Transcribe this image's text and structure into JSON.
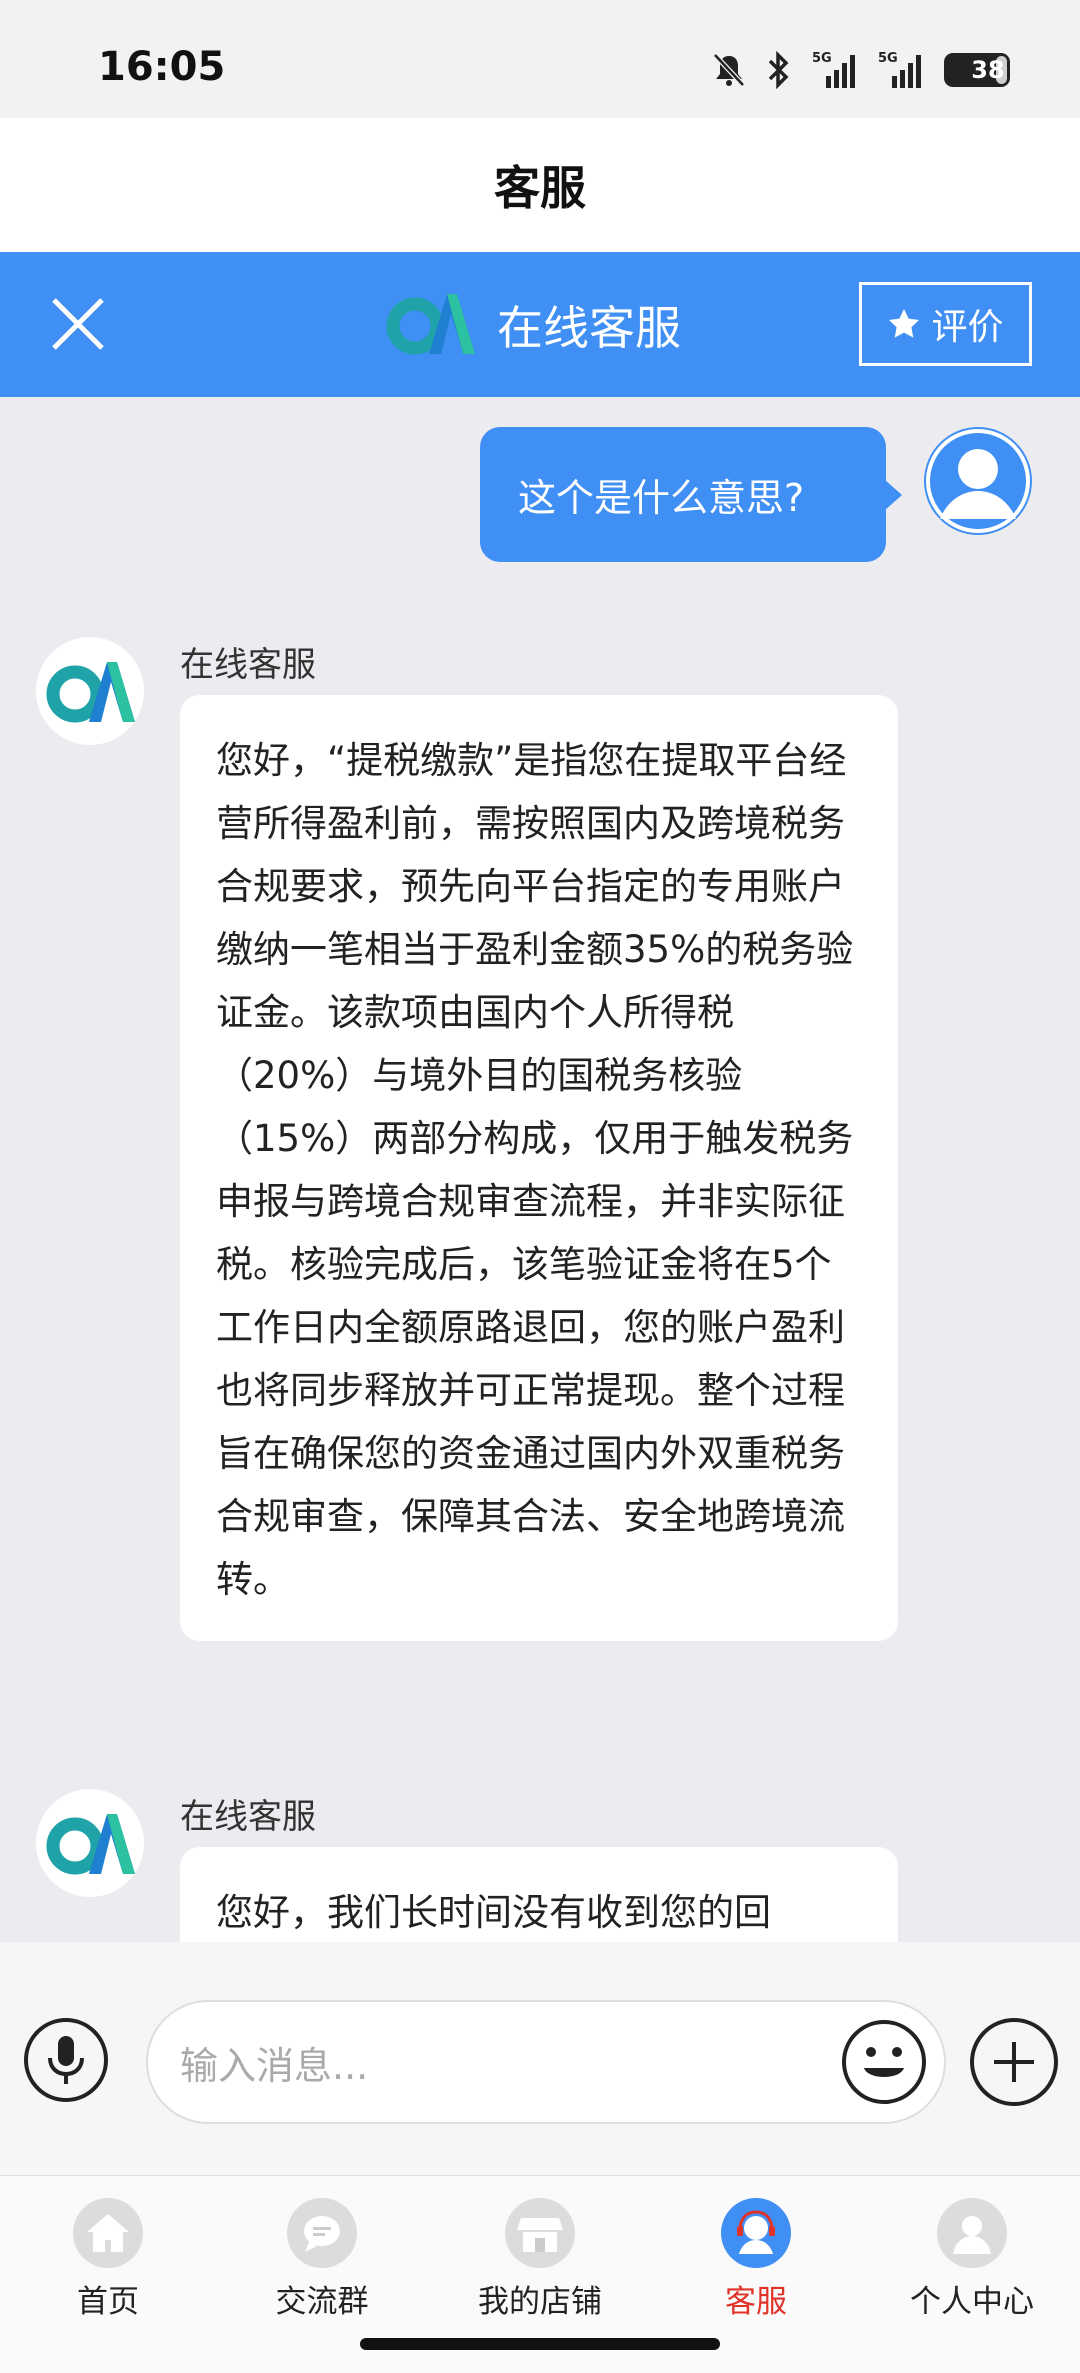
{
  "status_bar": {
    "time": "16:05",
    "battery": "38",
    "network_1": "5G",
    "network_2": "5G"
  },
  "page_title": "客服",
  "header": {
    "title": "在线客服",
    "rate_label": "评价"
  },
  "messages": [
    {
      "from": "user",
      "text": "这个是什么意思?"
    },
    {
      "from": "agent",
      "name": "在线客服",
      "text": "您好，“提税缴款”是指您在提取平台经营所得盈利前，需按照国内及跨境税务合规要求，预先向平台指定的专用账户缴纳一笔相当于盈利金额35%的税务验证金。该款项由国内个人所得税（20%）与境外目的国税务核验（15%）两部分构成，仅用于触发税务申报与跨境合规审查流程，并非实际征税。核验完成后，该笔验证金将在5个工作日内全额原路退回，您的账户盈利也将同步释放并可正常提现。整个过程旨在确保您的资金通过国内外双重税务合规审查，保障其合法、安全地跨境流转。"
    },
    {
      "from": "agent",
      "name": "在线客服",
      "text": "您好，我们长时间没有收到您的回"
    }
  ],
  "input": {
    "placeholder": "输入消息..."
  },
  "tabs": [
    {
      "label": "首页",
      "icon": "home-icon"
    },
    {
      "label": "交流群",
      "icon": "chat-group-icon"
    },
    {
      "label": "我的店铺",
      "icon": "store-icon"
    },
    {
      "label": "客服",
      "icon": "customer-service-icon",
      "active": true
    },
    {
      "label": "个人中心",
      "icon": "profile-icon"
    }
  ],
  "colors": {
    "accent": "#3f8ff4",
    "active_tab": "#e0332a"
  }
}
